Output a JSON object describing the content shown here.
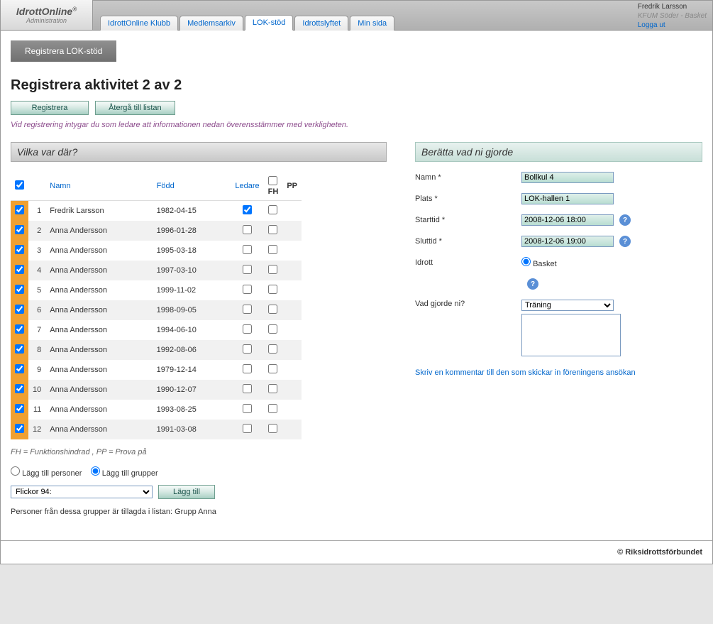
{
  "logo": {
    "main": "IdrottOnline",
    "sub": "Administration"
  },
  "user": {
    "name": "Fredrik Larsson",
    "org": "KFUM Söder - Basket",
    "logout": "Logga ut"
  },
  "nav": {
    "tabs": [
      "IdrottOnline Klubb",
      "Medlemsarkiv",
      "LOK-stöd",
      "Idrottslyftet",
      "Min sida"
    ],
    "active": 2
  },
  "subtab": "Registrera LOK-stöd",
  "page": {
    "title": "Registrera aktivitet 2 av 2",
    "btn_register": "Registrera",
    "btn_back": "Återgå till listan",
    "note": "Vid registrering intygar du som ledare att informationen nedan överensstämmer med verkligheten."
  },
  "left": {
    "header": "Vilka var där?",
    "columns": {
      "name": "Namn",
      "born": "Född",
      "leader": "Ledare",
      "fh": "FH",
      "pp": "PP"
    },
    "rows": [
      {
        "n": 1,
        "name": "Fredrik Larsson",
        "born": "1982-04-15",
        "leader": true,
        "fh": false
      },
      {
        "n": 2,
        "name": "Anna Andersson",
        "born": "1996-01-28",
        "leader": false,
        "fh": false
      },
      {
        "n": 3,
        "name": "Anna Andersson",
        "born": "1995-03-18",
        "leader": false,
        "fh": false
      },
      {
        "n": 4,
        "name": "Anna Andersson",
        "born": "1997-03-10",
        "leader": false,
        "fh": false
      },
      {
        "n": 5,
        "name": "Anna Andersson",
        "born": "1999-11-02",
        "leader": false,
        "fh": false
      },
      {
        "n": 6,
        "name": "Anna Andersson",
        "born": "1998-09-05",
        "leader": false,
        "fh": false
      },
      {
        "n": 7,
        "name": "Anna Andersson",
        "born": "1994-06-10",
        "leader": false,
        "fh": false
      },
      {
        "n": 8,
        "name": "Anna Andersson",
        "born": "1992-08-06",
        "leader": false,
        "fh": false
      },
      {
        "n": 9,
        "name": "Anna Andersson",
        "born": "1979-12-14",
        "leader": false,
        "fh": false
      },
      {
        "n": 10,
        "name": "Anna Andersson",
        "born": "1990-12-07",
        "leader": false,
        "fh": false
      },
      {
        "n": 11,
        "name": "Anna Andersson",
        "born": "1993-08-25",
        "leader": false,
        "fh": false
      },
      {
        "n": 12,
        "name": "Anna Andersson",
        "born": "1991-03-08",
        "leader": false,
        "fh": false
      }
    ],
    "legend": "FH = Funktionshindrad , PP = Prova på",
    "add_persons": "Lägg till personer",
    "add_groups": "Lägg till grupper",
    "group_selected": "Flickor 94:",
    "btn_add": "Lägg till",
    "added_note_prefix": "Personer från dessa grupper är tillagda i listan: ",
    "added_note_group": "Grupp Anna"
  },
  "right": {
    "header": "Berätta vad ni gjorde",
    "labels": {
      "name": "Namn *",
      "place": "Plats *",
      "start": "Starttid *",
      "end": "Sluttid *",
      "sport": "Idrott",
      "what": "Vad gjorde ni?"
    },
    "values": {
      "name": "Bollkul 4",
      "place": "LOK-hallen 1",
      "start": "2008-12-06 18:00",
      "end": "2008-12-06 19:00",
      "sport": "Basket",
      "what": "Träning"
    },
    "comment_link": "Skriv en kommentar till den som skickar in föreningens ansökan"
  },
  "footer": "© Riksidrottsförbundet"
}
